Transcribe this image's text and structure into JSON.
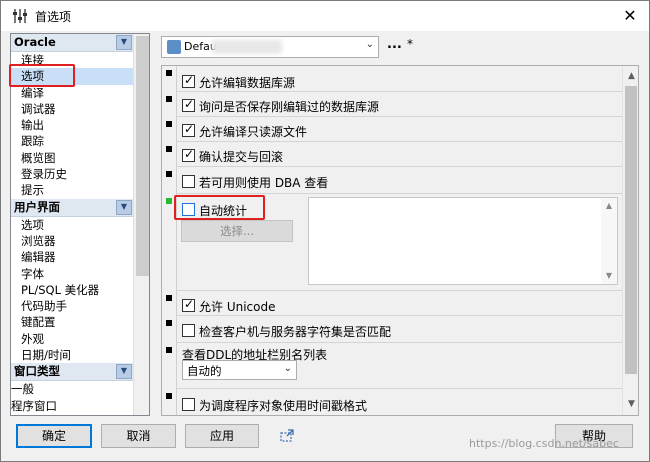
{
  "window": {
    "title": "首选项",
    "close_glyph": "✕"
  },
  "nav": {
    "groups": [
      {
        "label": "Oracle",
        "items": [
          "连接",
          "选项",
          "编译",
          "调试器",
          "输出",
          "跟踪",
          "概览图",
          "登录历史",
          "提示"
        ]
      },
      {
        "label": "用户界面",
        "items": [
          "选项",
          "浏览器",
          "编辑器",
          "字体",
          "PL/SQL 美化器",
          "代码助手",
          "键配置",
          "外观",
          "日期/时间"
        ]
      },
      {
        "label": "窗口类型",
        "items": [
          "一般",
          "程序窗口"
        ]
      }
    ],
    "selected": "选项"
  },
  "profile": {
    "value": "Defau",
    "ellipsis": "...",
    "modified": "*"
  },
  "options": {
    "allow_edit_datasource": {
      "label": "允许编辑数据库源",
      "checked": true
    },
    "ask_save": {
      "label": "询问是否保存刚编辑过的数据库源",
      "checked": true
    },
    "allow_compile_readonly": {
      "label": "允许编译只读源文件",
      "checked": true
    },
    "confirm_commit": {
      "label": "确认提交与回滚",
      "checked": true
    },
    "use_dba": {
      "label": "若可用则使用 DBA 查看",
      "checked": false
    },
    "auto_stats": {
      "label": "自动统计",
      "checked": false
    },
    "choose_button": "选择...",
    "allow_unicode": {
      "label": "允许 Unicode",
      "checked": true
    },
    "check_charset": {
      "label": "检查客户机与服务器字符集是否匹配",
      "checked": false
    },
    "ddl_alias": {
      "label": "查看DDL的地址栏别名列表",
      "value": "自动的"
    },
    "timestamp_debug": {
      "label": "为调度程序对象使用时间戳格式",
      "checked": false
    }
  },
  "buttons": {
    "ok": "确定",
    "cancel": "取消",
    "apply": "应用",
    "help": "帮助"
  },
  "watermark": "https://blog.csdn.net/sabec",
  "colors": {
    "highlight_box": "#e02020",
    "selected_bg": "#c9dff7",
    "accent": "#0078d7"
  }
}
